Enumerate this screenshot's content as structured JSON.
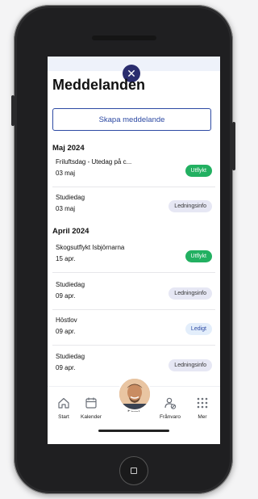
{
  "header": {
    "title": "Meddelanden",
    "close_icon": "close-icon"
  },
  "actions": {
    "create_label": "Skapa meddelande"
  },
  "sections": [
    {
      "label": "Maj 2024",
      "items": [
        {
          "title": "Friluftsdag - Utedag på c...",
          "date": "03 maj",
          "badge": "Utflykt",
          "badge_color": "#22b061"
        },
        {
          "title": "Studiedag",
          "date": "03 maj",
          "badge": "Ledningsinfo",
          "badge_color": "#e6e7f4"
        }
      ]
    },
    {
      "label": "April 2024",
      "items": [
        {
          "title": "Skogsutflykt Isbjörnarna",
          "date": "15 apr.",
          "badge": "Utflykt",
          "badge_color": "#22b061"
        },
        {
          "title": "Studiedag",
          "date": "09 apr.",
          "badge": "Ledningsinfo",
          "badge_color": "#e6e7f4"
        },
        {
          "title": "Höstlov",
          "date": "09 apr.",
          "badge": "Ledigt",
          "badge_color": "#e3eefb"
        },
        {
          "title": "Studiedag",
          "date": "09 apr.",
          "badge": "Ledningsinfo",
          "badge_color": "#e6e7f4"
        }
      ]
    }
  ],
  "nav": [
    {
      "label": "Start",
      "icon": "home-icon"
    },
    {
      "label": "Kalender",
      "icon": "calendar-icon"
    },
    {
      "label": "Peter",
      "icon": "avatar"
    },
    {
      "label": "Frånvaro",
      "icon": "absence-icon"
    },
    {
      "label": "Mer",
      "icon": "grid-icon"
    }
  ],
  "colors": {
    "accent": "#2d4aa3",
    "brand_dark": "#2a2d6e",
    "success": "#22b061"
  }
}
